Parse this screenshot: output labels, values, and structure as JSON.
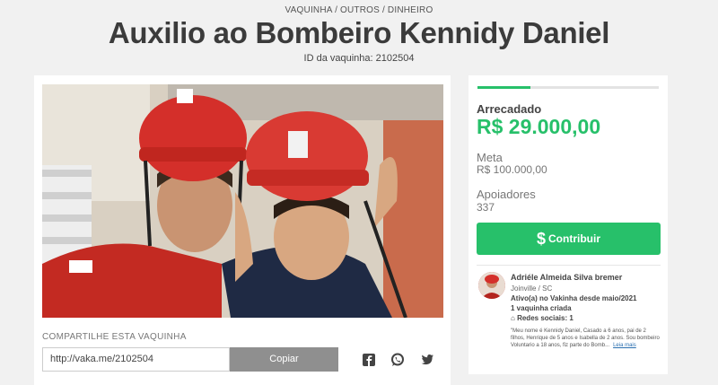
{
  "header": {
    "breadcrumb": "VAQUINHA / OUTROS / DINHEIRO",
    "title": "Auxilio ao Bombeiro Kennidy Daniel",
    "id_text": "ID da vaquinha: 2102504"
  },
  "share": {
    "label": "COMPARTILHE ESTA VAQUINHA",
    "url": "http://vaka.me/2102504",
    "copy_label": "Copiar",
    "icons": [
      "facebook-icon",
      "whatsapp-icon",
      "twitter-icon"
    ]
  },
  "stats": {
    "progress_fraction": 0.29,
    "raised_label": "Arrecadado",
    "raised_value": "R$ 29.000,00",
    "goal_label": "Meta",
    "goal_value": "R$ 100.000,00",
    "supporters_label": "Apoiadores",
    "supporters_value": "337",
    "contribute_label": "Contribuir"
  },
  "organizer": {
    "name": "Adriéle Almeida Silva bremer",
    "city": "Joinville / SC",
    "active_since": "Ativo(a) no Vakinha desde maio/2021",
    "campaigns_created": "1 vaquinha criada",
    "social_networks": "Redes sociais: 1",
    "description": "\"Meu nome é Kennidy Daniel, Casado a 6 anos, pai de 2 filhos, Henrique de 5 anos e Isabella de 2 anos. Sou bombeiro Voluntario a 18 anos, fiz parte do Bomb...",
    "read_more": "Leia mais"
  },
  "colors": {
    "accent": "#27c06a",
    "copy_button": "#8f8f8f",
    "background": "#f1f1f1"
  }
}
